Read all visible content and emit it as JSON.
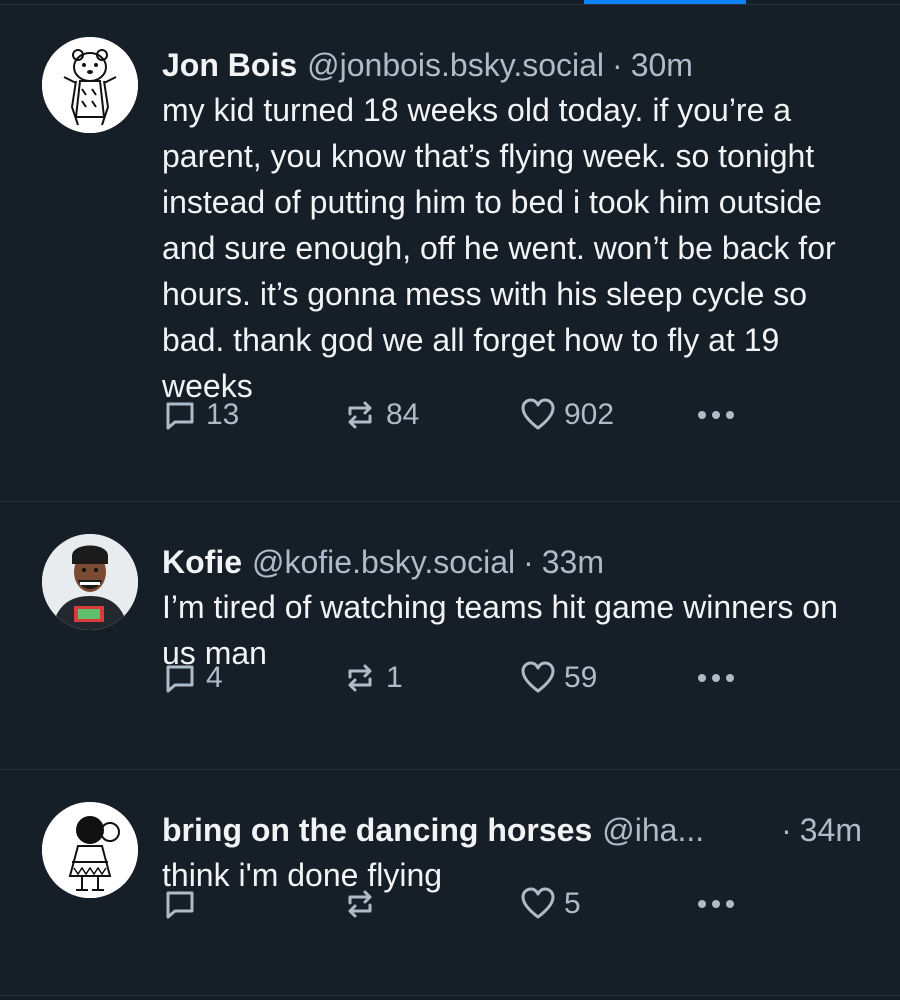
{
  "feed": {
    "posts": [
      {
        "name": "Jon Bois",
        "handle": "@jonbois.bsky.social",
        "separator": "·",
        "time": "30m",
        "text": "my kid turned 18 weeks old today. if you’re a parent, you know that’s flying week. so tonight instead of putting him to bed i took him outside and sure enough, off he went. won’t be back for hours. it’s gonna mess with his sleep cycle so bad. thank god we all forget how to fly at 19 weeks",
        "replies": "13",
        "reposts": "84",
        "likes": "902"
      },
      {
        "name": "Kofie",
        "handle": "@kofie.bsky.social",
        "separator": "·",
        "time": "33m",
        "text": "I’m tired of watching teams hit game winners on us man",
        "replies": "4",
        "reposts": "1",
        "likes": "59"
      },
      {
        "name": "bring on the dancing horses",
        "handle": "@iha...",
        "separator": "·",
        "time": "34m",
        "text": "think i'm done flying",
        "replies": "",
        "reposts": "",
        "likes": "5"
      }
    ]
  },
  "icons": {
    "reply": "reply-icon",
    "repost": "repost-icon",
    "like": "heart-icon",
    "more": "more-icon"
  },
  "colors": {
    "background": "#161e27",
    "accent": "#1083fe",
    "text": "#f1f3f5",
    "muted": "#aebbc9",
    "divider": "#2a3441"
  }
}
